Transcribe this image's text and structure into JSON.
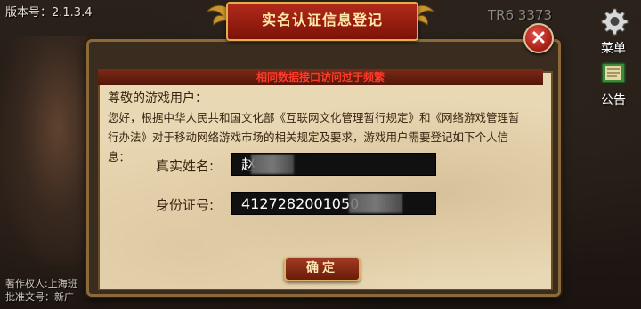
{
  "game": {
    "version": "版本号：2.1.3.4",
    "server_id": "TR6   3373",
    "copyright_line1": "著作权人:上海班",
    "copyright_line2": "批准文号：新广"
  },
  "side_menu": {
    "menu_label": "菜单",
    "menu_icon": "gear-icon",
    "notice_label": "公告",
    "notice_icon": "book-icon"
  },
  "dialog": {
    "title": "实名认证信息登记",
    "warning": "相同数据接口访问过于频繁",
    "greeting": "尊敬的游戏用户：",
    "body": "您好，根据中华人民共和国文化部《互联网文化管理暂行规定》和《网络游戏管理暂行办法》对于移动网络游戏市场的相关规定及要求，游戏用户需要登记如下个人信息：",
    "name_label": "真实姓名:",
    "name_value": "赵",
    "id_label": "身份证号:",
    "id_value": "4127282001050",
    "confirm_label": "确定",
    "close_icon": "close-icon"
  },
  "colors": {
    "title_red": "#b22a1a",
    "warning_red": "#ff3a2a",
    "parchment": "#e9d8b4",
    "gold_border": "#e0b04a"
  }
}
